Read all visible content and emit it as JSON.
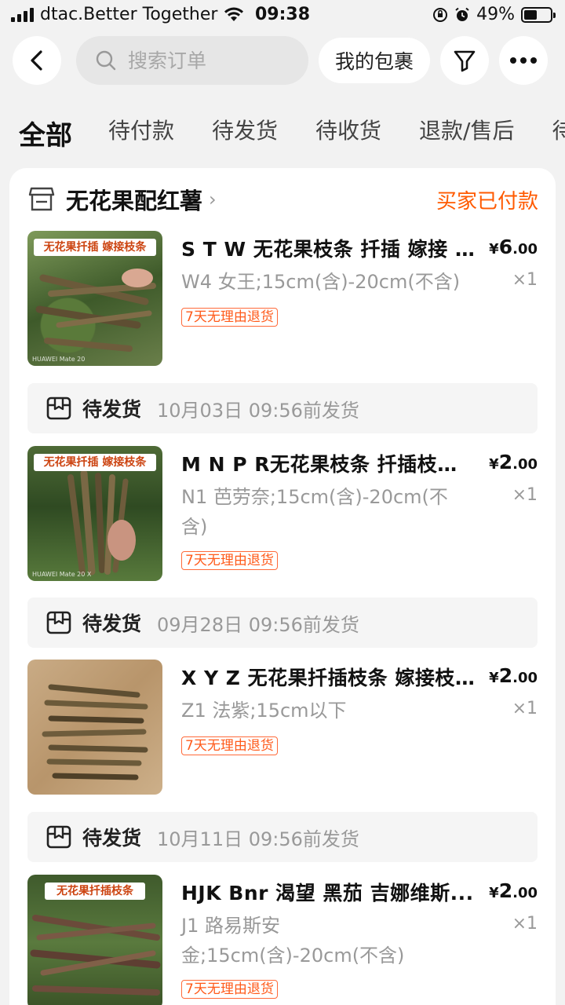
{
  "status_bar": {
    "carrier": "dtac.Better Together",
    "time": "09:38",
    "battery": "49%",
    "battery_level": 0.49
  },
  "header": {
    "search_placeholder": "搜索订单",
    "my_package_label": "我的包裹",
    "icons": [
      "back-icon",
      "search-icon",
      "filter-icon",
      "more-icon"
    ]
  },
  "tabs": [
    "全部",
    "待付款",
    "待发货",
    "待收货",
    "退款/售后",
    "待"
  ],
  "order": {
    "shop_name": "无花果配红薯",
    "status": "买家已付款",
    "accent_color": "#ff5a00",
    "products": [
      {
        "image_banner": "无花果扦插 嫁接枝条",
        "title": "S T W 无花果枝条 扦插 嫁接 ...",
        "price_symbol": "¥",
        "price_int": "6",
        "price_dec": ".00",
        "spec": "W4 女王;15cm(含)-20cm(不含)",
        "qty": "×1",
        "tag": "7天无理由退货"
      },
      {
        "image_banner": "无花果扦插 嫁接枝条",
        "title": "M N P R无花果枝条 扦插枝条...",
        "price_symbol": "¥",
        "price_int": "2",
        "price_dec": ".00",
        "spec": "N1 芭劳奈;15cm(含)-20cm(不含)",
        "qty": "×1",
        "tag": "7天无理由退货"
      },
      {
        "image_banner": "",
        "title": "X Y Z 无花果扦插枝条 嫁接枝...",
        "price_symbol": "¥",
        "price_int": "2",
        "price_dec": ".00",
        "spec": "Z1 法紫;15cm以下",
        "qty": "×1",
        "tag": "7天无理由退货"
      },
      {
        "image_banner": "无花果扦插枝条",
        "title": "HJK Bnr 渴望 黑茄 吉娜维斯...",
        "price_symbol": "¥",
        "price_int": "2",
        "price_dec": ".00",
        "spec": "J1 路易斯安金;15cm(含)-20cm(不含)",
        "qty": "×1",
        "tag": "7天无理由退货"
      }
    ],
    "shipping": [
      {
        "label": "待发货",
        "time": "10月03日 09:56前发货"
      },
      {
        "label": "待发货",
        "time": "09月28日 09:56前发货"
      },
      {
        "label": "待发货",
        "time": "10月11日 09:56前发货"
      }
    ]
  }
}
